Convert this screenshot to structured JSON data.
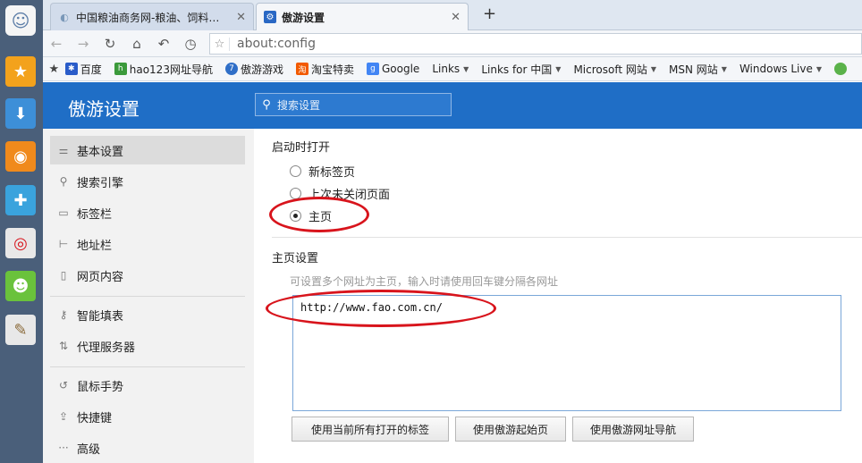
{
  "tabs": [
    {
      "title": "中国粮油商务网-粮油、饲料…",
      "close": "✕"
    },
    {
      "title": "傲游设置",
      "close": "✕"
    }
  ],
  "newtab": "+",
  "address": {
    "url": "about:config"
  },
  "bookmarks": [
    {
      "label": "百度",
      "color": "#2a5cc9",
      "dropdown": false
    },
    {
      "label": "hao123网址导航",
      "color": "#3b9a3b",
      "dropdown": false
    },
    {
      "label": "傲游游戏",
      "color": "#2f6ec7",
      "dropdown": false
    },
    {
      "label": "淘宝特卖",
      "color": "#f25a00",
      "dropdown": false
    },
    {
      "label": "Google",
      "color": "#4285f4",
      "dropdown": false
    },
    {
      "label": "Links",
      "color": "",
      "dropdown": true
    },
    {
      "label": "Links for 中国",
      "color": "",
      "dropdown": true
    },
    {
      "label": "Microsoft 网站",
      "color": "",
      "dropdown": true
    },
    {
      "label": "MSN 网站",
      "color": "",
      "dropdown": true
    },
    {
      "label": "Windows Live",
      "color": "",
      "dropdown": true
    }
  ],
  "header": {
    "title": "傲游设置",
    "search_placeholder": "搜索设置"
  },
  "nav": [
    {
      "label": "基本设置",
      "icon": "sliders-icon"
    },
    {
      "label": "搜索引擎",
      "icon": "search-icon"
    },
    {
      "label": "标签栏",
      "icon": "tabs-icon"
    },
    {
      "label": "地址栏",
      "icon": "addressbar-icon"
    },
    {
      "label": "网页内容",
      "icon": "page-icon"
    },
    {
      "label": "智能填表",
      "icon": "key-icon"
    },
    {
      "label": "代理服务器",
      "icon": "proxy-icon"
    },
    {
      "label": "鼠标手势",
      "icon": "mouse-gesture-icon"
    },
    {
      "label": "快捷键",
      "icon": "shortcut-icon"
    },
    {
      "label": "高级",
      "icon": "more-icon"
    }
  ],
  "startup": {
    "title": "启动时打开",
    "options": [
      "新标签页",
      "上次未关闭页面",
      "主页"
    ],
    "selected": 2
  },
  "homepage": {
    "title": "主页设置",
    "hint": "可设置多个网址为主页，输入时请使用回车键分隔各网址",
    "value": "http://www.fao.com.cn/",
    "buttons": [
      "使用当前所有打开的标签",
      "使用傲游起始页",
      "使用傲游网址导航"
    ]
  },
  "colors": {
    "accent": "#1f6ec6",
    "annotation": "#d8141c"
  }
}
